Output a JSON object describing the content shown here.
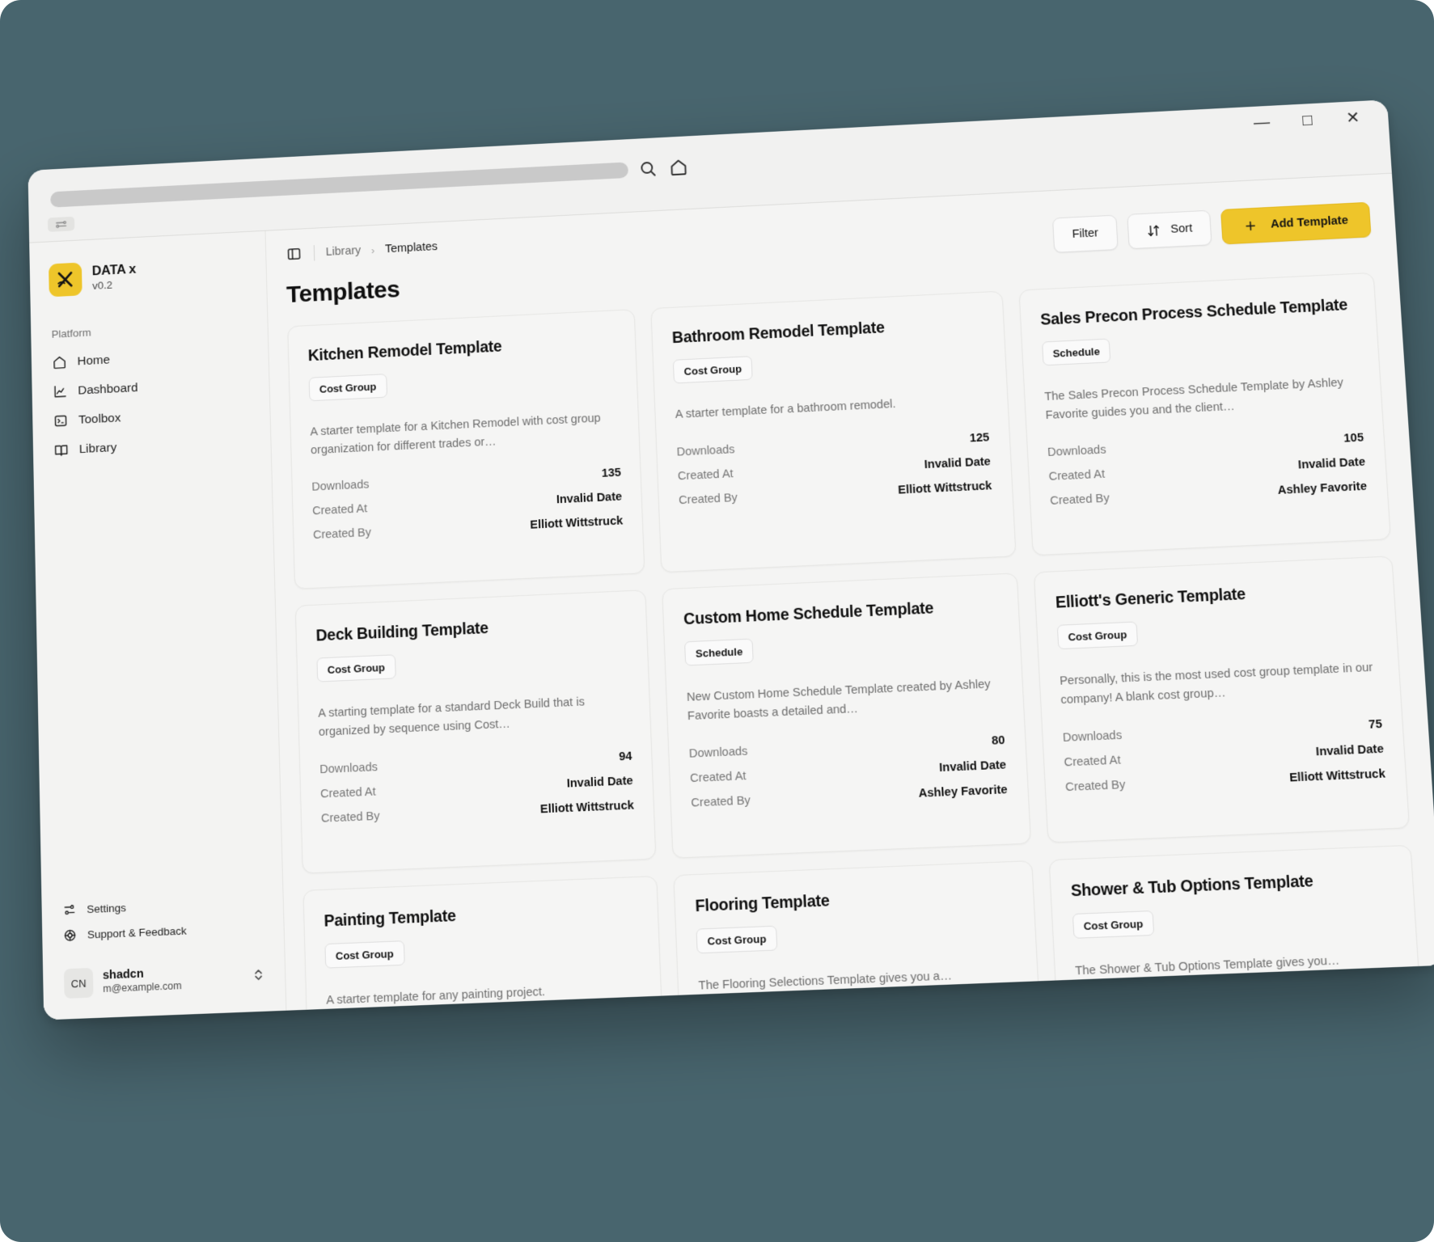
{
  "browser": {
    "url_value": "",
    "search_icon": "search-icon",
    "home_icon": "home-icon",
    "minimize_label": "—",
    "maximize_label": "□",
    "close_label": "✕"
  },
  "sidebar": {
    "brand": {
      "logo_glyph": "X",
      "name": "DATA x",
      "version": "v0.2",
      "accent": "#eec52a"
    },
    "group_label": "Platform",
    "items": [
      {
        "label": "Home",
        "icon": "home-icon"
      },
      {
        "label": "Dashboard",
        "icon": "chart-line-icon"
      },
      {
        "label": "Toolbox",
        "icon": "toolbox-icon"
      },
      {
        "label": "Library",
        "icon": "book-icon"
      }
    ],
    "footer_items": [
      {
        "label": "Settings",
        "icon": "sliders-icon"
      },
      {
        "label": "Support & Feedback",
        "icon": "lifebuoy-icon"
      }
    ],
    "user": {
      "initials": "CN",
      "name": "shadcn",
      "email": "m@example.com",
      "chevron": "⌃⌄"
    }
  },
  "header": {
    "panel_toggle_icon": "panel-left-icon",
    "breadcrumb": {
      "parent": "Library",
      "separator": "›",
      "current": "Templates"
    },
    "page_title": "Templates",
    "buttons": {
      "filter": "Filter",
      "sort": "Sort",
      "sort_icon": "sort-arrows-icon",
      "add": "Add Template",
      "add_icon": "plus-icon"
    }
  },
  "labels": {
    "downloads": "Downloads",
    "created_at": "Created At",
    "created_by": "Created By"
  },
  "cards": [
    {
      "title": "Kitchen Remodel Template",
      "badge": "Cost Group",
      "description": "A starter template for a Kitchen Remodel with cost group organization for different trades or…",
      "downloads": "135",
      "created_at": "Invalid Date",
      "created_by": "Elliott Wittstruck"
    },
    {
      "title": "Bathroom Remodel Template",
      "badge": "Cost Group",
      "description": "A starter template for a bathroom remodel.",
      "downloads": "125",
      "created_at": "Invalid Date",
      "created_by": "Elliott Wittstruck"
    },
    {
      "title": "Sales Precon Process Schedule Template",
      "badge": "Schedule",
      "description": "The Sales Precon Process Schedule Template by Ashley Favorite guides you and the client…",
      "downloads": "105",
      "created_at": "Invalid Date",
      "created_by": "Ashley Favorite"
    },
    {
      "title": "Deck Building Template",
      "badge": "Cost Group",
      "description": "A starting template for a standard Deck Build that is organized by sequence using Cost…",
      "downloads": "94",
      "created_at": "Invalid Date",
      "created_by": "Elliott Wittstruck"
    },
    {
      "title": "Custom Home Schedule Template",
      "badge": "Schedule",
      "description": "New Custom Home Schedule Template created by Ashley Favorite boasts a detailed and…",
      "downloads": "80",
      "created_at": "Invalid Date",
      "created_by": "Ashley Favorite"
    },
    {
      "title": "Elliott's Generic Template",
      "badge": "Cost Group",
      "description": "Personally, this is the most used cost group template in our company! A blank cost group…",
      "downloads": "75",
      "created_at": "Invalid Date",
      "created_by": "Elliott Wittstruck"
    },
    {
      "title": "Painting Template",
      "badge": "Cost Group",
      "description": "A starter template for any painting project.",
      "downloads": "",
      "created_at": "",
      "created_by": ""
    },
    {
      "title": "Flooring Template",
      "badge": "Cost Group",
      "description": "The Flooring Selections Template gives you a…",
      "downloads": "",
      "created_at": "",
      "created_by": ""
    },
    {
      "title": "Shower & Tub Options Template",
      "badge": "Cost Group",
      "description": "The Shower & Tub Options Template gives you…",
      "downloads": "",
      "created_at": "",
      "created_by": ""
    }
  ]
}
